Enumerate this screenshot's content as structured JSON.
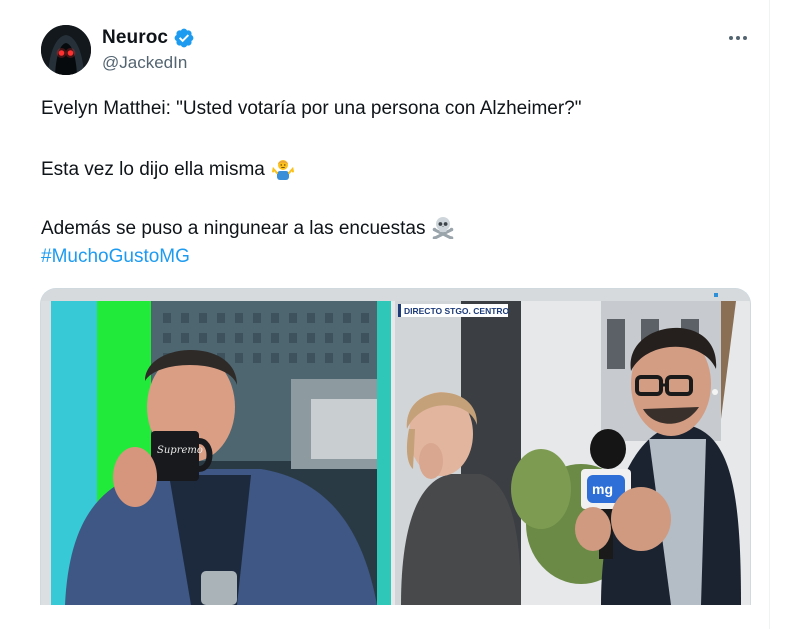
{
  "tweet": {
    "author": {
      "display_name": "Neuroc",
      "handle": "@JackedIn",
      "verified": true,
      "avatar_icon": "hooded-figure-avatar"
    },
    "more_icon": "more-dots-icon",
    "text_lines": [
      "Evelyn Matthei: \"Usted votaría por una persona con Alzheimer?\"",
      "Esta vez lo dijo ella misma",
      "Además se puso a ningunear a las encuestas"
    ],
    "emojis": [
      "person-shrugging-emoji",
      "skull-and-crossbones-emoji"
    ],
    "hashtag": "#MuchoGustoMG",
    "media": {
      "overlay_label": "DIRECTO STGO. CENTRO",
      "mug_text": "Supremo",
      "mic_logo": "mg"
    }
  },
  "colors": {
    "link": "#1d9bf0",
    "verified": "#1d9bf0",
    "secondary_text": "#536471",
    "primary_text": "#0f1419",
    "border": "#cfd9de"
  }
}
